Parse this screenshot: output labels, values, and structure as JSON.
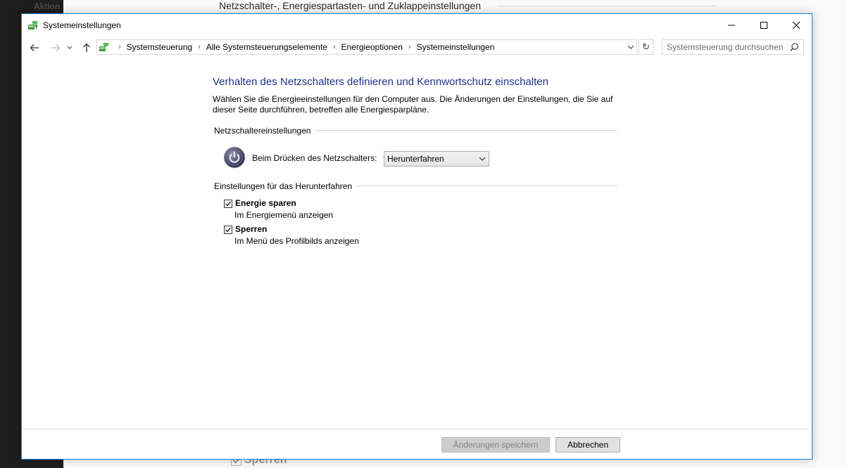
{
  "background": {
    "left_label": "Aktion",
    "title": "Netzschalter-, Energiespartasten- und Zuklappeinstellungen",
    "bottom_label": "Sperren"
  },
  "window": {
    "title": "Systemeinstellungen",
    "controls": {
      "minimize": "minimize-icon",
      "maximize": "maximize-icon",
      "close": "close-icon"
    }
  },
  "addressbar": {
    "breadcrumbs": [
      "Systemsteuerung",
      "Alle Systemsteuerungselemente",
      "Energieoptionen",
      "Systemeinstellungen"
    ],
    "search_placeholder": "Systemsteuerung durchsuchen"
  },
  "page": {
    "heading": "Verhalten des Netzschalters definieren und Kennwortschutz einschalten",
    "description": "Wählen Sie die Energieeinstellungen für den Computer aus. Die Änderungen der Einstellungen, die Sie auf dieser Seite durchführen, betreffen alle Energiesparpläne.",
    "power_section": {
      "title": "Netzschaltereinstellungen",
      "label": "Beim Drücken des Netzschalters:",
      "selected": "Herunterfahren"
    },
    "shutdown_section": {
      "title": "Einstellungen für das Herunterfahren",
      "options": [
        {
          "label": "Energie sparen",
          "description": "Im Energiemenü anzeigen",
          "checked": true
        },
        {
          "label": "Sperren",
          "description": "Im Menü des Profilbilds anzeigen",
          "checked": true
        }
      ]
    }
  },
  "footer": {
    "save_label": "Änderungen speichern",
    "save_enabled": false,
    "cancel_label": "Abbrechen"
  },
  "colors": {
    "heading": "#1e3287",
    "window_border": "#1883d7"
  }
}
